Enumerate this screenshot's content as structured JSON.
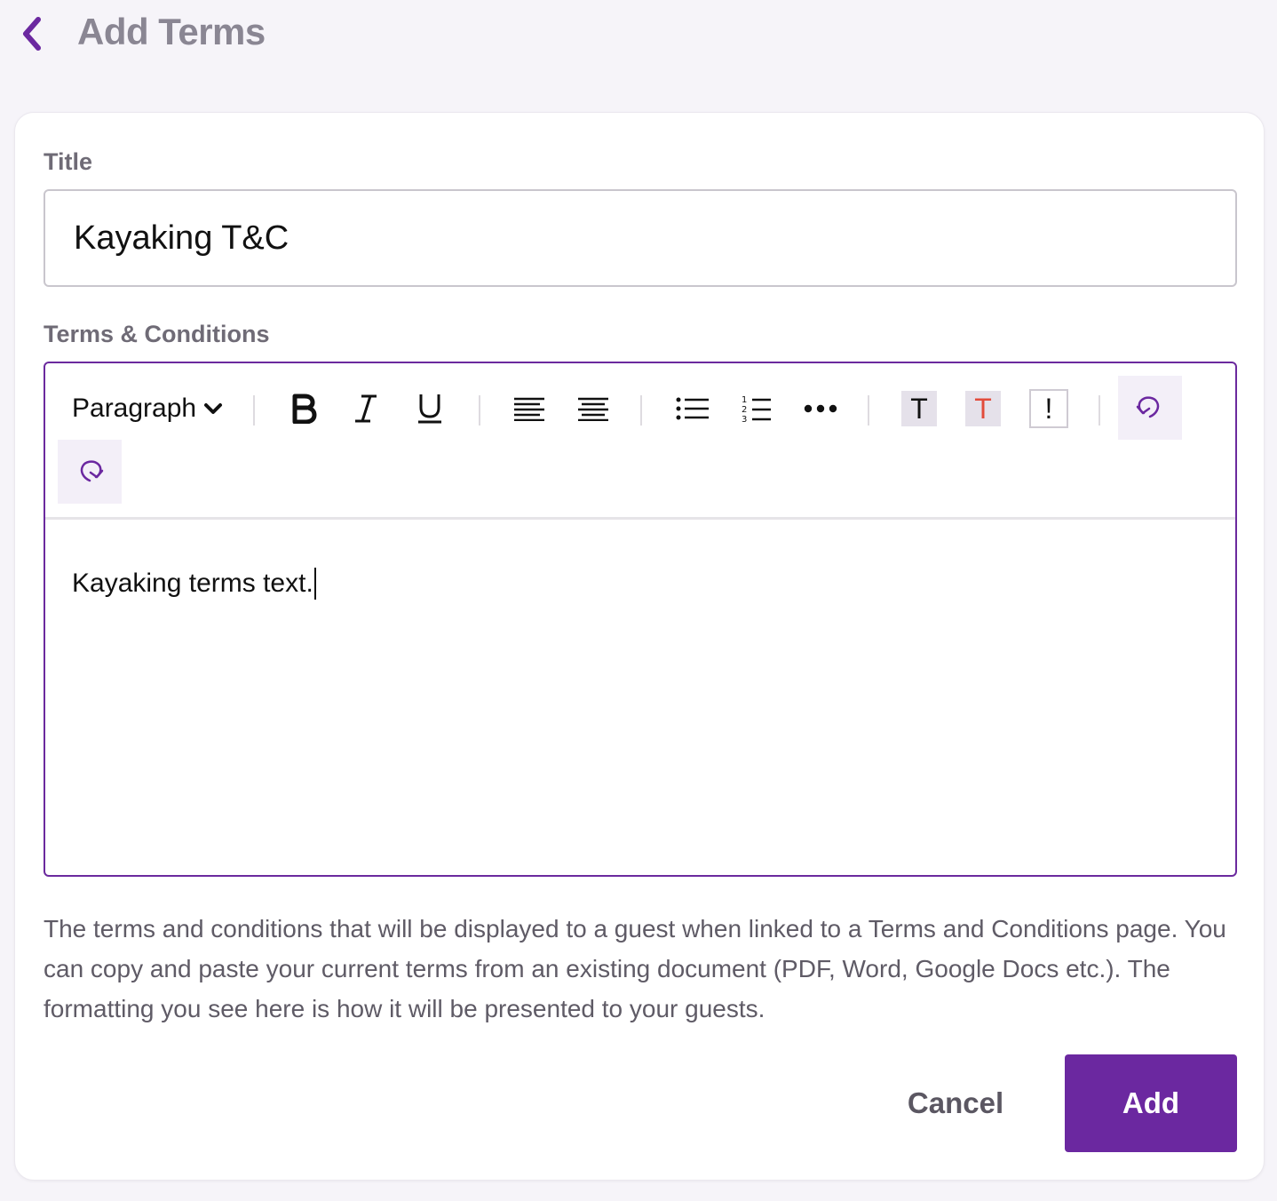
{
  "header": {
    "title": "Add Terms",
    "back_icon": "chevron-left-icon"
  },
  "colors": {
    "accent": "#6b28a0",
    "page_background": "#f6f4f9",
    "card_background": "#ffffff",
    "label_text": "#6f6b76",
    "text_color_sample": "#e24b3b"
  },
  "form": {
    "title_label": "Title",
    "title_value": "Kayaking T&C",
    "terms_label": "Terms & Conditions",
    "editor": {
      "block_format": "Paragraph",
      "toolbar": [
        {
          "name": "bold",
          "icon": "bold-icon"
        },
        {
          "name": "italic",
          "icon": "italic-icon"
        },
        {
          "name": "underline",
          "icon": "underline-icon"
        },
        {
          "name": "align-left",
          "icon": "align-left-icon"
        },
        {
          "name": "align-center",
          "icon": "align-center-icon"
        },
        {
          "name": "bullet-list",
          "icon": "bullet-list-icon"
        },
        {
          "name": "numbered-list",
          "icon": "numbered-list-icon"
        },
        {
          "name": "more",
          "icon": "more-icon"
        },
        {
          "name": "text-background",
          "icon": "text-background-icon",
          "glyph": "T"
        },
        {
          "name": "text-color",
          "icon": "text-color-icon",
          "glyph": "T"
        },
        {
          "name": "special-character",
          "icon": "special-character-icon",
          "glyph": "!"
        },
        {
          "name": "undo",
          "icon": "undo-icon"
        },
        {
          "name": "redo",
          "icon": "redo-icon"
        }
      ],
      "content": "Kayaking terms text."
    },
    "help_text": "The terms and conditions that will be displayed to a guest when linked to a Terms and Conditions page. You can copy and paste your current terms from an existing document (PDF, Word, Google Docs etc.). The formatting you see here is how it will be presented to your guests."
  },
  "actions": {
    "cancel_label": "Cancel",
    "add_label": "Add"
  }
}
